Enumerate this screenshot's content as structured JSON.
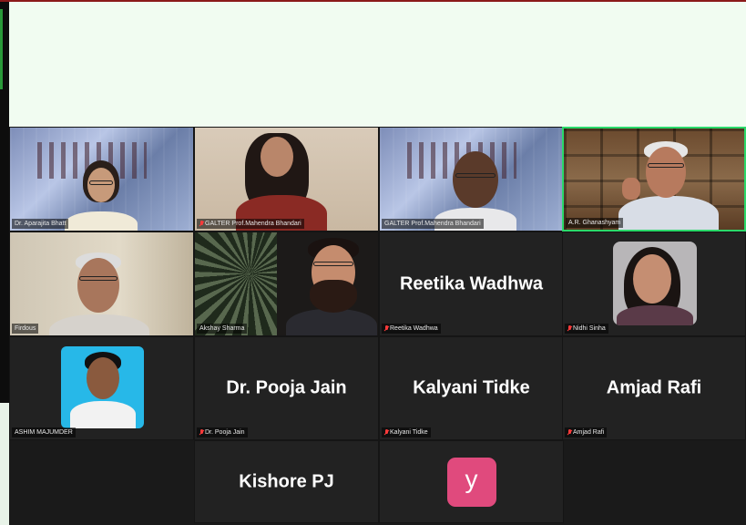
{
  "colors": {
    "banner": "#f1fcf1",
    "tile": "#222222",
    "active_speaker_border": "#2bd96a",
    "muted_mic": "#ff3b3b",
    "avatar_y": "#e04a7d"
  },
  "participants": [
    {
      "label": "Dr. Aparajita Bhatt",
      "muted": false,
      "video": true
    },
    {
      "label": "GALTER Prof.Mahendra Bhandari",
      "muted": true,
      "video": true
    },
    {
      "label": "GALTER Prof.Mahendra Bhandari",
      "muted": false,
      "video": true
    },
    {
      "label": "A.R. Ghanashyam",
      "muted": false,
      "video": true,
      "active_speaker": true
    },
    {
      "label": "Firdous",
      "muted": false,
      "video": true
    },
    {
      "label": "Akshay Sharma",
      "muted": false,
      "video": true
    },
    {
      "label": "Reetika Wadhwa",
      "display_name": "Reetika Wadhwa",
      "muted": true,
      "video": false
    },
    {
      "label": "Nidhi Sinha",
      "muted": true,
      "video": false
    },
    {
      "label": "ASHIM MAJUMDER",
      "muted": false,
      "video": false
    },
    {
      "label": "Dr. Pooja Jain",
      "display_name": "Dr. Pooja Jain",
      "muted": true,
      "video": false
    },
    {
      "label": "Kalyani Tidke",
      "display_name": "Kalyani Tidke",
      "muted": true,
      "video": false
    },
    {
      "label": "Amjad Rafi",
      "display_name": "Amjad Rafi",
      "muted": true,
      "video": false
    },
    {
      "display_name": "Kishore PJ",
      "video": false
    },
    {
      "avatar_letter": "y",
      "video": false
    }
  ]
}
